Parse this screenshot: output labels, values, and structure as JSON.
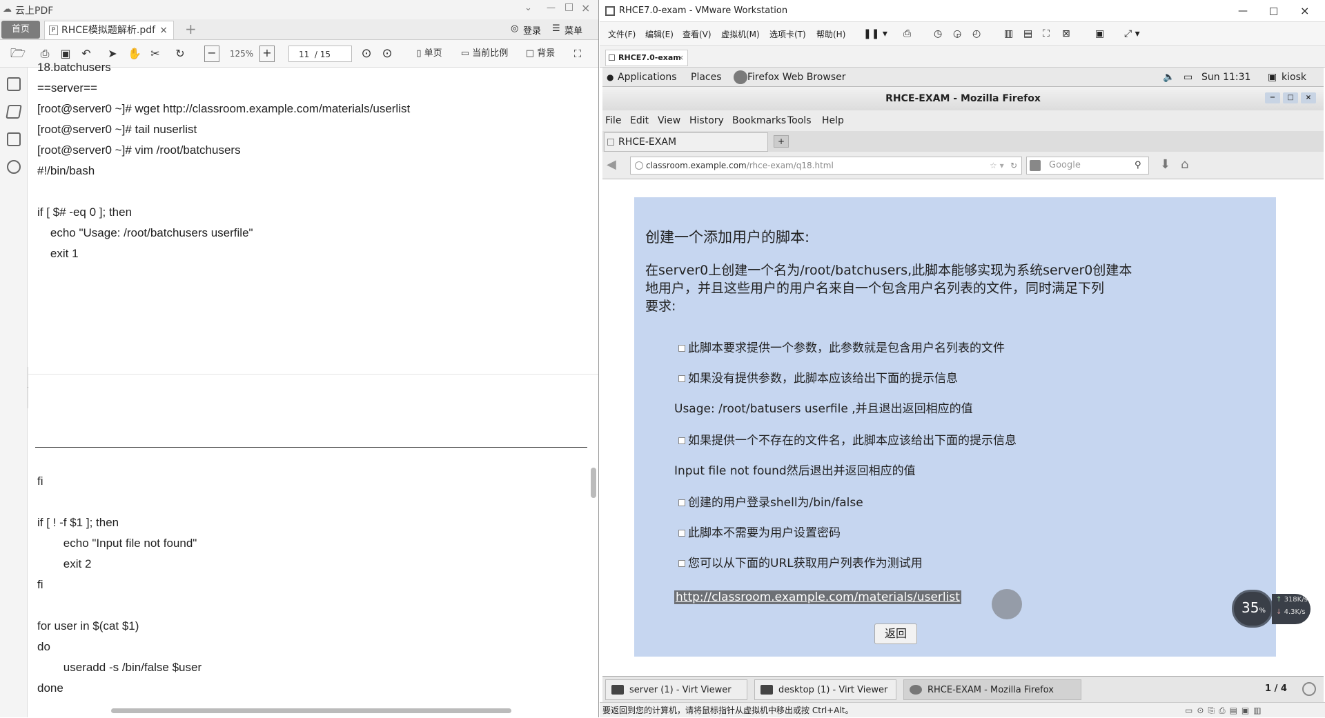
{
  "pdf_app": {
    "app_title": "云上PDF",
    "home_label": "首页",
    "tab_label": "RHCE模拟题解析.pdf",
    "tab_close": "×",
    "new_tab": "+",
    "login_label": "登录",
    "menu_label": "菜单",
    "zoom": "125%",
    "page_current": "11",
    "page_total": "/ 15",
    "single_page": "单页",
    "current_ratio": "当前比例",
    "background": "背景",
    "window_controls": [
      "⌄",
      "—",
      "□",
      "×"
    ]
  },
  "pdf_content": {
    "top_block": [
      "18.batchusers",
      "==server==",
      "[root@server0 ~]# wget http://classroom.example.com/materials/userlist",
      "[root@server0 ~]# tail nuserlist",
      "[root@server0 ~]# vim /root/batchusers",
      "#!/bin/bash",
      "",
      "if [ $# -eq 0 ]; then",
      "    echo \"Usage: /root/batchusers userfile\"",
      "    exit 1"
    ],
    "bottom_block": [
      "fi",
      "",
      "if [ ! -f $1 ]; then",
      "        echo \"Input file not found\"",
      "        exit 2",
      "fi",
      "",
      "for user in $(cat $1)",
      "do",
      "        useradd -s /bin/false $user",
      "done"
    ]
  },
  "vmware": {
    "title": "RHCE7.0-exam - VMware Workstation",
    "menus": [
      "文件(F)",
      "编辑(E)",
      "查看(V)",
      "虚拟机(M)",
      "选项卡(T)",
      "帮助(H)"
    ],
    "vm_tab": "RHCE7.0-exam",
    "vm_tab_close": "×",
    "window_controls": [
      "—",
      "□",
      "×"
    ],
    "status_text": "要返回到您的计算机，请将鼠标指针从虚拟机中移出或按 Ctrl+Alt。"
  },
  "gnome": {
    "applications": "Applications",
    "places": "Places",
    "firefox": "Firefox Web Browser",
    "clock": "Sun 11:31",
    "user": "kiosk"
  },
  "firefox": {
    "title": "RHCE-EXAM - Mozilla Firefox",
    "menus": [
      "File",
      "Edit",
      "View",
      "History",
      "Bookmarks",
      "Tools",
      "Help"
    ],
    "tab": "RHCE-EXAM",
    "url_host": "classroom.example.com",
    "url_path": "/rhce-exam/q18.html",
    "search_placeholder": "Google"
  },
  "question": {
    "heading": "创建一个添加用户的脚本:",
    "intro_1": "在server0上创建一个名为/root/batchusers,此脚本能够实现为系统server0创建本",
    "intro_2": "地用户，并且这些用户的用户名来自一个包含用户名列表的文件，同时满足下列",
    "intro_3": "要求:",
    "items": [
      "此脚本要求提供一个参数，此参数就是包含用户名列表的文件",
      "如果没有提供参数，此脚本应该给出下面的提示信息",
      "Usage: /root/batusers userfile ,并且退出返回相应的值",
      "如果提供一个不存在的文件名，此脚本应该给出下面的提示信息",
      "Input file not found然后退出并返回相应的值",
      "创建的用户登录shell为/bin/false",
      "此脚本不需要为用户设置密码",
      "您可以从下面的URL获取用户列表作为测试用"
    ],
    "link": "http://classroom.example.com/materials/userlist",
    "back_button": "返回"
  },
  "taskbar": {
    "items": [
      "server (1) - Virt Viewer",
      "desktop (1) - Virt Viewer",
      "RHCE-EXAM - Mozilla Firefox"
    ],
    "workspace": "1 / 4"
  },
  "net_widget": {
    "percent": "35",
    "percent_unit": "%",
    "up": "318K/s",
    "down": "4.3K/s"
  }
}
